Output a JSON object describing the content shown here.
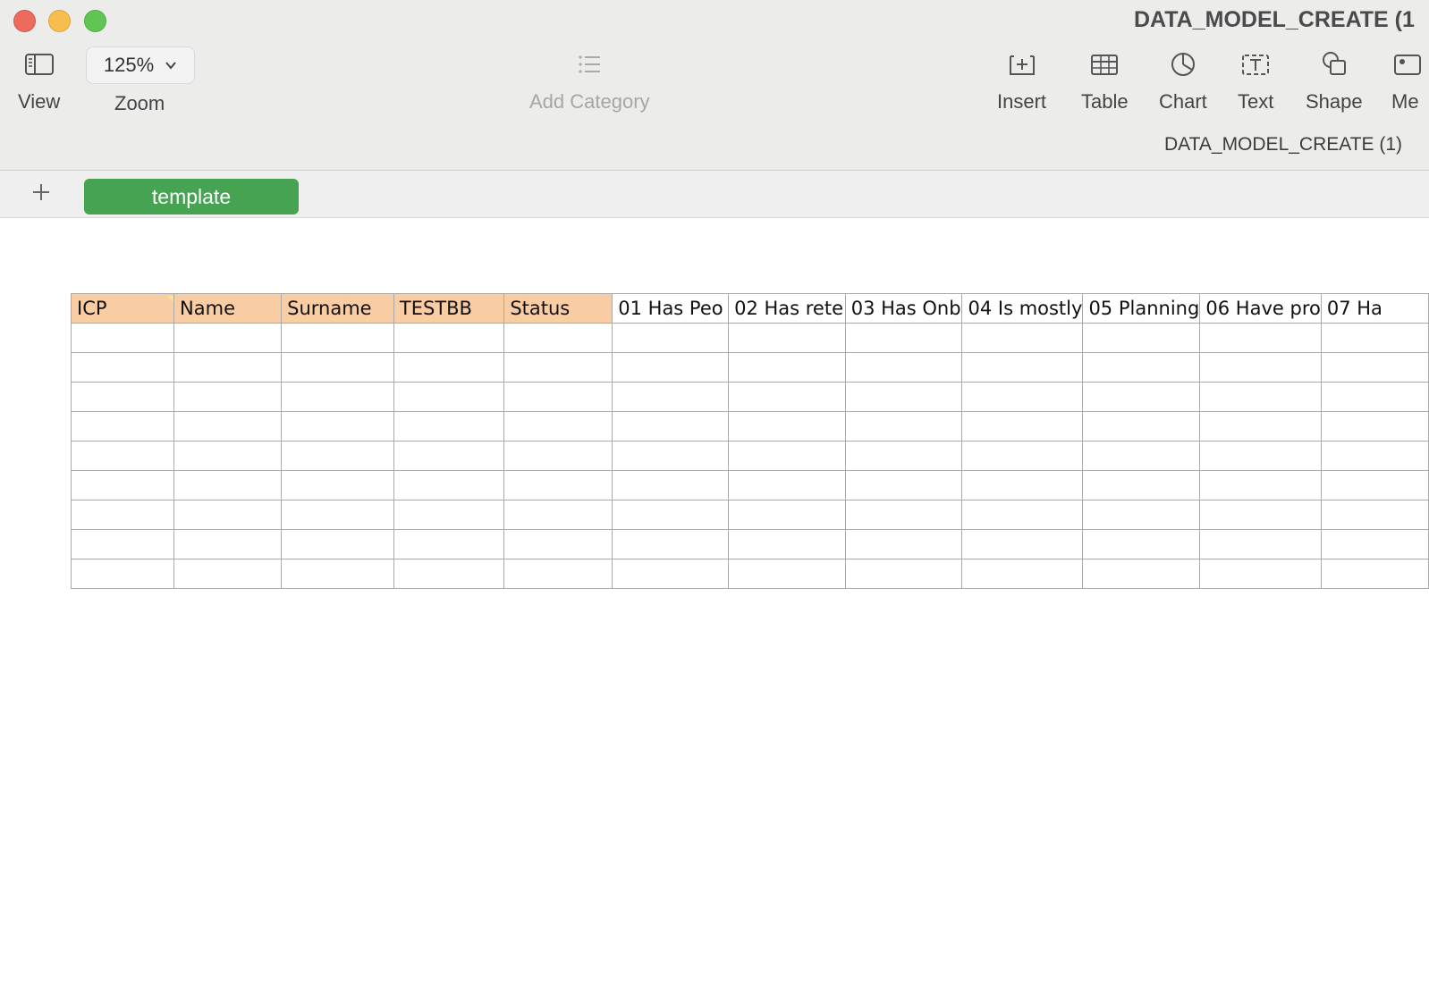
{
  "window": {
    "title": "DATA_MODEL_CREATE (1",
    "subtitle": "DATA_MODEL_CREATE (1)"
  },
  "toolbar": {
    "view_label": "View",
    "zoom_value": "125%",
    "zoom_label": "Zoom",
    "add_category_label": "Add Category",
    "insert_label": "Insert",
    "table_label": "Table",
    "chart_label": "Chart",
    "text_label": "Text",
    "shape_label": "Shape",
    "media_label": "Me"
  },
  "sheets": {
    "active_tab": "template"
  },
  "table": {
    "headers": [
      {
        "label": "ICP",
        "highlight": true
      },
      {
        "label": "Name",
        "highlight": true
      },
      {
        "label": "Surname",
        "highlight": true
      },
      {
        "label": "TESTBB",
        "highlight": true
      },
      {
        "label": "Status",
        "highlight": true
      },
      {
        "label": "01 Has Peo",
        "highlight": false
      },
      {
        "label": "02 Has rete",
        "highlight": false
      },
      {
        "label": "03 Has Onb",
        "highlight": false
      },
      {
        "label": "04 Is mostly",
        "highlight": false
      },
      {
        "label": "05 Planning",
        "highlight": false
      },
      {
        "label": "06 Have pro",
        "highlight": false
      },
      {
        "label": "07 Ha",
        "highlight": false
      }
    ],
    "row_count": 9,
    "header_color": "#f9cda4"
  }
}
